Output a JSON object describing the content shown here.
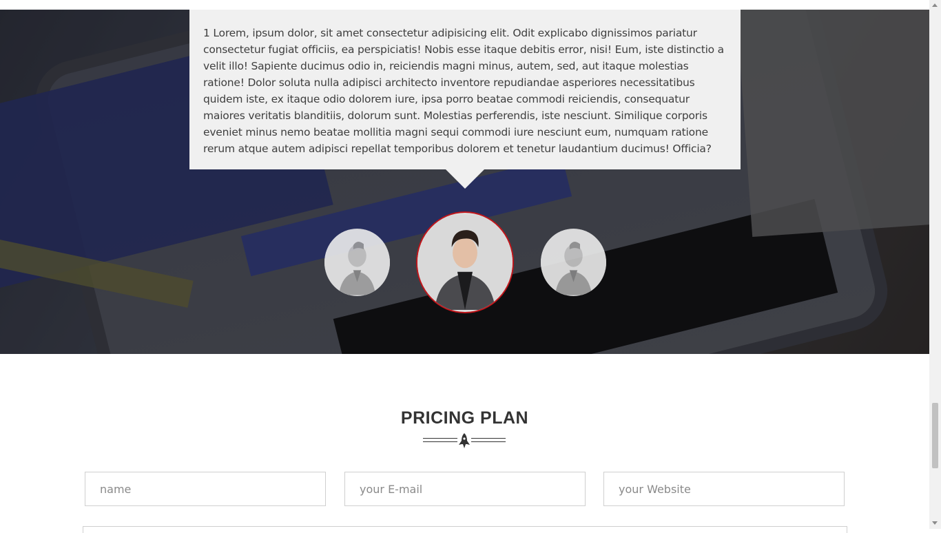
{
  "testimonial": {
    "text": "1 Lorem, ipsum dolor, sit amet consectetur adipisicing elit. Odit explicabo dignissimos pariatur consectetur fugiat officiis, ea perspiciatis! Nobis esse itaque debitis error, nisi! Eum, iste distinctio a velit illo! Sapiente ducimus odio in, reiciendis magni minus, autem, sed, aut itaque molestias ratione! Dolor soluta nulla adipisci architecto inventore repudiandae asperiores necessitatibus quidem iste, ex itaque odio dolorem iure, ipsa porro beatae commodi reiciendis, consequatur maiores veritatis blanditiis, dolorum sunt. Molestias perferendis, iste nesciunt. Similique corporis eveniet minus nemo beatae mollitia magni sequi commodi iure nesciunt eum, numquam ratione rerum atque autem adipisci repellat temporibus dolorem et tenetur laudantium ducimus! Officia?"
  },
  "avatars": [
    {
      "state": "inactive"
    },
    {
      "state": "active",
      "accent": "#c0161b"
    },
    {
      "state": "inactive"
    }
  ],
  "pricing": {
    "title": "PRICING PLAN",
    "divider_icon": "rocket-icon"
  },
  "form": {
    "name_placeholder": "name",
    "email_placeholder": "your E-mail",
    "website_placeholder": "your Website"
  },
  "colors": {
    "accent": "#c0161b",
    "bubble_bg": "#f0f0f0",
    "title": "#333333"
  }
}
